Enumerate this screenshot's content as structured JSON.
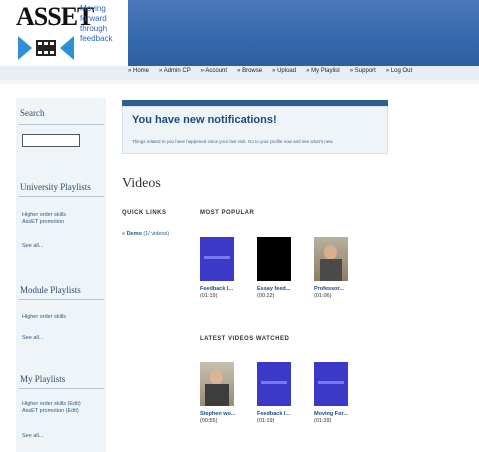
{
  "brand": {
    "logo": "ASSET",
    "tagline_line1": "Moving forward",
    "tagline_line2": "through feedback"
  },
  "nav": [
    "» Home",
    "» Admin CP",
    "» Account",
    "» Browse",
    "» Upload",
    "» My Playlist",
    "» Support",
    "» Log Out"
  ],
  "sidebar": {
    "search_title": "Search",
    "university_title": "University Playlists",
    "university_items": [
      "Higher order skills",
      "AssET promotion"
    ],
    "university_see_all": "See all...",
    "module_title": "Module Playlists",
    "module_items": [
      "Higher order skills"
    ],
    "module_see_all": "See all...",
    "my_title": "My Playlists",
    "my_items": [
      "Higher order skills (Edit)",
      "AssET promotion (Edit)"
    ],
    "my_see_all": "See all..."
  },
  "notification": {
    "title": "You have new notifications!",
    "text": "Things related to you have happened since your last visit. Go to your profile now and see what's new."
  },
  "videos": {
    "title": "Videos",
    "quick_links_title": "QUICK LINKS",
    "quick_link": "» Demo",
    "quick_link_count": "(1/ videos)",
    "popular_title": "MOST POPULAR",
    "popular": [
      {
        "title": "Feedback I...",
        "duration": "(01:19)"
      },
      {
        "title": "Essay feed...",
        "duration": "(00:22)"
      },
      {
        "title": "Professor...",
        "duration": "(01:06)"
      }
    ],
    "latest_title": "LATEST VIDEOS WATCHED",
    "latest": [
      {
        "title": "Stephen wo...",
        "duration": "(00:55)"
      },
      {
        "title": "Feedback I...",
        "duration": "(01:19)"
      },
      {
        "title": "Moving For...",
        "duration": "(01:29)"
      }
    ]
  },
  "colors": {
    "header": "#3569ae",
    "link": "#2a5a8a",
    "sidebar_bg": "#eef4f8"
  }
}
